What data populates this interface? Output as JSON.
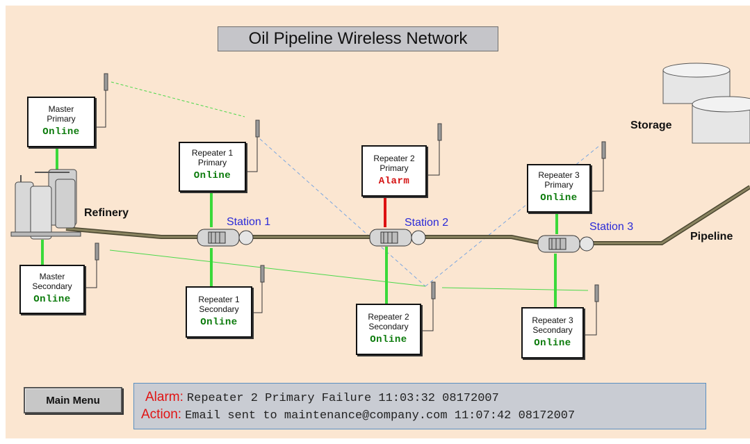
{
  "title": "Oil Pipeline Wireless Network",
  "nodes": {
    "master_primary": {
      "line1": "Master",
      "line2": "Primary",
      "status": "Online"
    },
    "master_secondary": {
      "line1": "Master",
      "line2": "Secondary",
      "status": "Online"
    },
    "repeater1_primary": {
      "line1": "Repeater 1",
      "line2": "Primary",
      "status": "Online"
    },
    "repeater1_secondary": {
      "line1": "Repeater 1",
      "line2": "Secondary",
      "status": "Online"
    },
    "repeater2_primary": {
      "line1": "Repeater 2",
      "line2": "Primary",
      "status": "Alarm"
    },
    "repeater2_secondary": {
      "line1": "Repeater 2",
      "line2": "Secondary",
      "status": "Online"
    },
    "repeater3_primary": {
      "line1": "Repeater 3",
      "line2": "Primary",
      "status": "Online"
    },
    "repeater3_secondary": {
      "line1": "Repeater 3",
      "line2": "Secondary",
      "status": "Online"
    }
  },
  "labels": {
    "refinery": "Refinery",
    "storage": "Storage",
    "pipeline": "Pipeline",
    "station1": "Station 1",
    "station2": "Station 2",
    "station3": "Station 3"
  },
  "main_menu_label": "Main Menu",
  "message": {
    "alarm_key": "Alarm:",
    "alarm_text": "Repeater 2 Primary Failure 11:03:32  08172007",
    "action_key": "Action:",
    "action_text": "Email sent to maintenance@company.com 11:07:42 08172007"
  },
  "colors": {
    "background": "#fbe6d1",
    "online": "#0a7a0a",
    "alarm": "#d41111",
    "link_ok": "#3ad93a",
    "link_alarm": "#dd1111",
    "pipe": "#7a7450",
    "station_label": "#2a2ad8"
  },
  "icons": [
    "antenna-icon",
    "pump-station-icon",
    "refinery-tanks-icon",
    "storage-tank-icon"
  ]
}
